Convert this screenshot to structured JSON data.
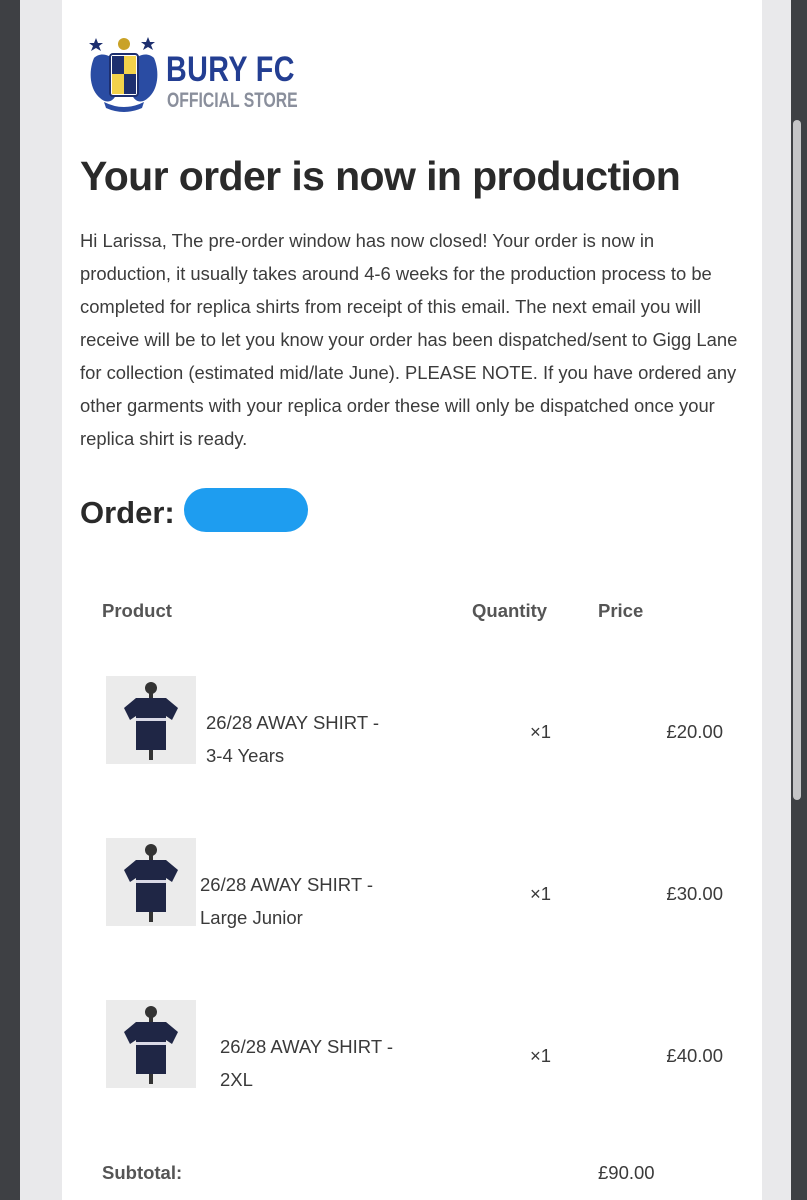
{
  "store": {
    "name": "BURY FC",
    "subtitle": "OFFICIAL STORE",
    "brand_color": "#233e92"
  },
  "email": {
    "heading": "Your order is now in production",
    "message": "Hi Larissa, The pre-order window has now closed! Your order is now in production, it usually takes around 4-6 weeks for the production process to be completed for replica shirts from receipt of this email. The next email you will receive will be to let you know your order has been dispatched/sent to Gigg Lane for collection (estimated mid/late June). PLEASE NOTE. If you have ordered any other garments with your replica order these will only be dispatched once your replica shirt is ready.",
    "order_label": "Order:",
    "redaction_color": "#1e9df0"
  },
  "table": {
    "headers": {
      "product": "Product",
      "quantity": "Quantity",
      "price": "Price"
    },
    "items": [
      {
        "name_line1": "26/28 AWAY SHIRT -",
        "name_line2": "3-4 Years",
        "quantity": "×1",
        "price": "£20.00",
        "thumb_icon": "away-shirt-icon"
      },
      {
        "name_line1": "26/28 AWAY SHIRT -",
        "name_line2": "Large Junior",
        "quantity": "×1",
        "price": "£30.00",
        "thumb_icon": "away-shirt-icon"
      },
      {
        "name_line1": "26/28 AWAY SHIRT -",
        "name_line2": "2XL",
        "quantity": "×1",
        "price": "£40.00",
        "thumb_icon": "away-shirt-icon"
      }
    ],
    "subtotal_label": "Subtotal:",
    "subtotal_value": "£90.00"
  }
}
